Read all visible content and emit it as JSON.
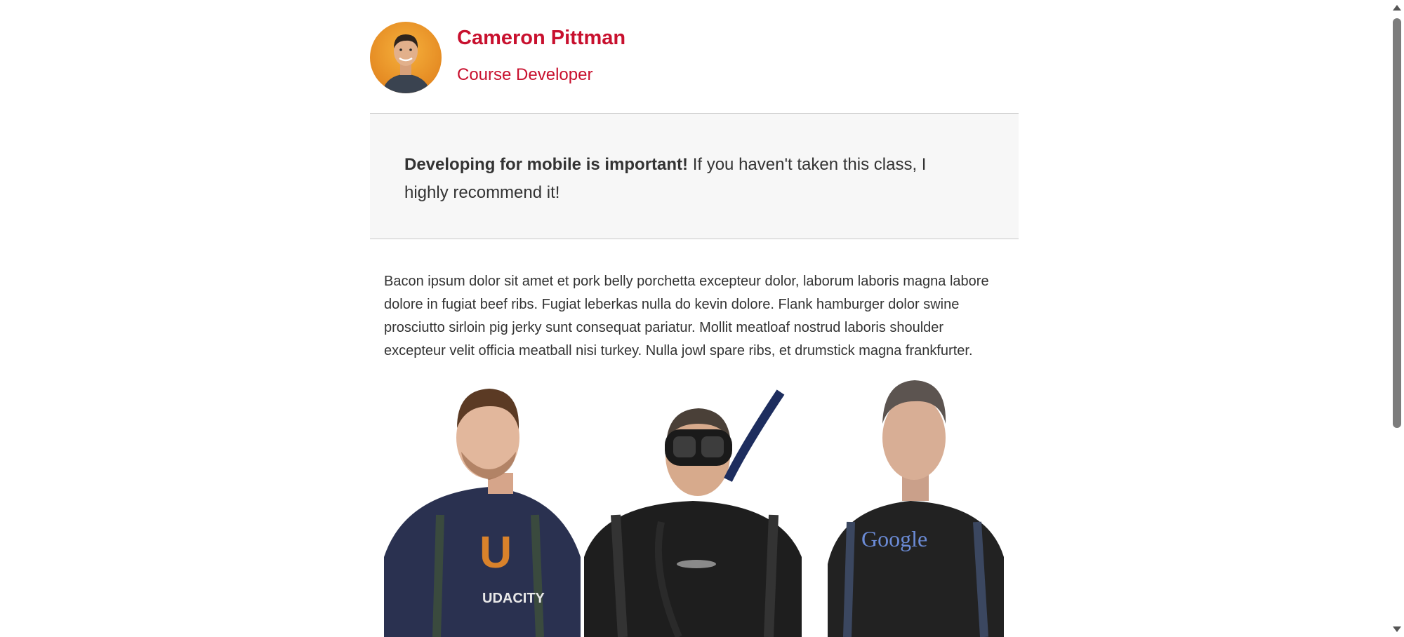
{
  "author": {
    "name": "Cameron Pittman",
    "role": "Course Developer"
  },
  "callout": {
    "bold": "Developing for mobile is important!",
    "rest": " If you haven't taken this class, I highly recommend it!"
  },
  "article": {
    "paragraph": "Bacon ipsum dolor sit amet et pork belly porchetta excepteur dolor, laborum laboris magna labore dolore in fugiat beef ribs. Fugiat leberkas nulla do kevin dolore. Flank hamburger dolor swine prosciutto sirloin pig jerky sunt consequat pariatur. Mollit meatloaf nostrud laboris shoulder excepteur velit officia meatball nisi turkey. Nulla jowl spare ribs, et drumstick magna frankfurter."
  },
  "photo": {
    "shirt_left": "UDACITY",
    "shirt_right": "Google"
  },
  "colors": {
    "accent": "#c8102e",
    "text": "#333333",
    "callout_bg": "#f7f7f7",
    "divider": "#c9c9c9"
  }
}
